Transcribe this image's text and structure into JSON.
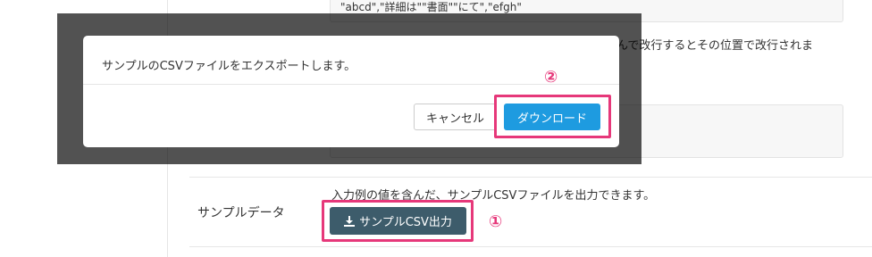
{
  "background": {
    "code_sample": "\"abcd\",\"詳細は\"\"書面\"\"にて\",\"efgh\"",
    "right_note": "んで改行するとその位置で改行されま"
  },
  "row": {
    "label": "サンプルデータ",
    "description": "入力例の値を含んだ、サンプルCSVファイルを出力できます。",
    "export_button_label": "サンプルCSV出力",
    "export_button_icon": "download-icon"
  },
  "modal": {
    "message": "サンプルのCSVファイルをエクスポートします。",
    "cancel_label": "キャンセル",
    "download_label": "ダウンロード"
  },
  "annotations": {
    "marker_1": "①",
    "marker_2": "②",
    "color": "#e6387a"
  },
  "colors": {
    "export_button": "#3d5c6b",
    "download_button": "#1e9be0"
  }
}
